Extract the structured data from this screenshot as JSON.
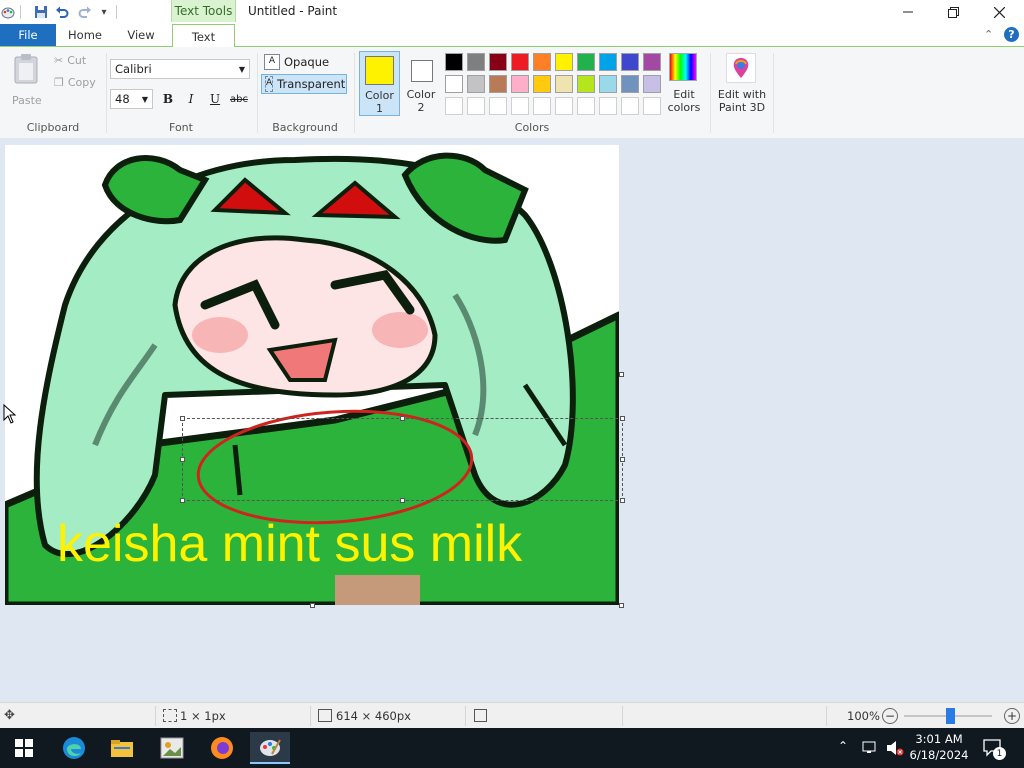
{
  "window": {
    "title": "Untitled - Paint",
    "context_tab": "Text Tools"
  },
  "tabs": [
    "File",
    "Home",
    "View",
    "Text"
  ],
  "ribbon": {
    "clipboard": {
      "paste": "Paste",
      "cut": "Cut",
      "copy": "Copy",
      "label": "Clipboard"
    },
    "font": {
      "family": "Calibri",
      "size": "48",
      "bold": "B",
      "italic": "I",
      "underline": "U",
      "strike": "abc",
      "label": "Font"
    },
    "background": {
      "opaque": "Opaque",
      "transparent": "Transparent",
      "label": "Background"
    },
    "color1": {
      "line1": "Color",
      "line2": "1",
      "value": "#fff200"
    },
    "color2": {
      "line1": "Color",
      "line2": "2",
      "value": "#ffffff"
    },
    "colors_label": "Colors",
    "edit_colors": {
      "line1": "Edit",
      "line2": "colors"
    },
    "paint3d": {
      "line1": "Edit with",
      "line2": "Paint 3D"
    },
    "palette_row1": [
      "#000000",
      "#7f7f7f",
      "#880015",
      "#ed1c24",
      "#ff7f27",
      "#fff200",
      "#22b14c",
      "#00a2e8",
      "#3f48cc",
      "#a349a4"
    ],
    "palette_row2": [
      "#ffffff",
      "#c3c3c3",
      "#b97a57",
      "#ffaec9",
      "#ffc90e",
      "#efe4b0",
      "#b5e61d",
      "#99d9ea",
      "#7092be",
      "#c8bfe7"
    ]
  },
  "canvas": {
    "overlay_text": "keisha mint sus milk",
    "text_color": "#fff200"
  },
  "statusbar": {
    "selection": "1 × 1px",
    "size": "614 × 460px",
    "zoom": "100%"
  },
  "taskbar": {
    "time": "3:01 AM",
    "date": "6/18/2024",
    "notification_count": "1"
  }
}
